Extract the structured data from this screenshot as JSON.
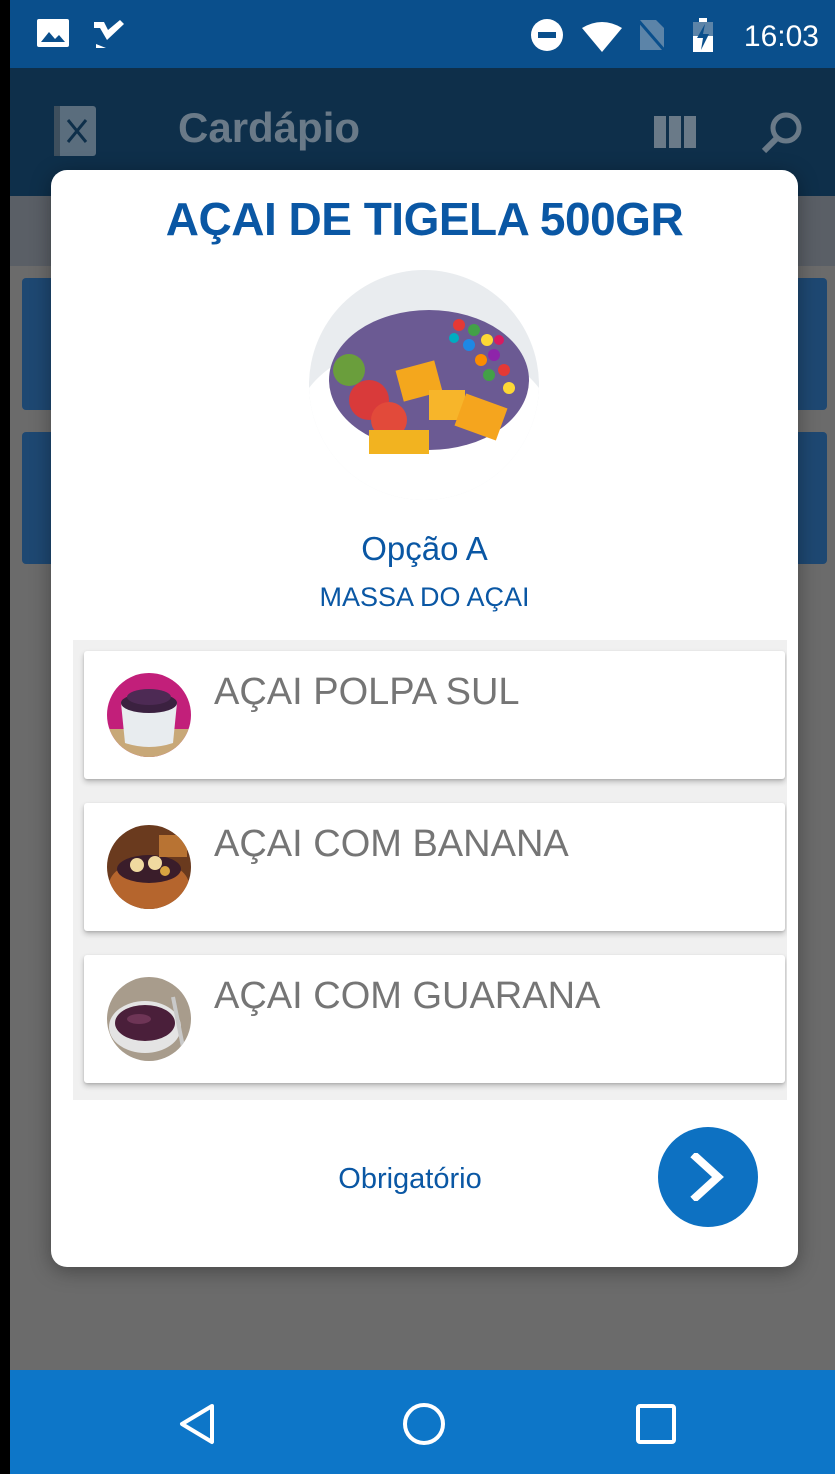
{
  "status_bar": {
    "time": "16:03",
    "left_icons": [
      "image-icon",
      "check-notification-icon"
    ],
    "right_icons": [
      "do-not-disturb-icon",
      "wifi-icon",
      "no-sim-icon",
      "battery-charging-icon"
    ]
  },
  "app_bar": {
    "title": "Cardápio",
    "icons": [
      "menu-book-icon",
      "grid-view-icon",
      "search-icon"
    ]
  },
  "dialog": {
    "title": "AÇAI DE TIGELA 500GR",
    "option_name": "Opção A",
    "option_description": "MASSA DO AÇAI",
    "items": [
      {
        "label": "AÇAI POLPA SUL"
      },
      {
        "label": "AÇAI COM BANANA"
      },
      {
        "label": "AÇAI COM GUARANA"
      }
    ],
    "required_label": "Obrigatório",
    "next_icon": "chevron-right-icon"
  },
  "nav_bar": {
    "icons": [
      "back-icon",
      "home-icon",
      "recents-icon"
    ]
  },
  "colors": {
    "accent": "#0a57a4",
    "status_bar": "#0a4f8c",
    "nav_bar": "#0d76c8",
    "next_button": "#0d71c2"
  }
}
